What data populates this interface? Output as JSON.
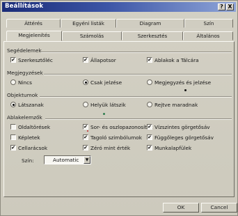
{
  "window": {
    "title": "Beállítások",
    "help_glyph": "?",
    "close_glyph": "X"
  },
  "tabs_row1": [
    "Áttérés",
    "Egyéni listák",
    "Diagram",
    "Szín"
  ],
  "tabs_row2": [
    "Megjelenítés",
    "Számolás",
    "Szerkesztés",
    "Általános"
  ],
  "active_tab": "Megjelenítés",
  "groups": {
    "segedelemek": {
      "label": "Segédelemek",
      "items": [
        {
          "label": "Szerkesztőléc",
          "checked": true
        },
        {
          "label": "Állapotsor",
          "checked": true
        },
        {
          "label": "Ablakok a Tálcára",
          "checked": true
        }
      ]
    },
    "megjegyzesek": {
      "label": "Megjegyzések",
      "items": [
        {
          "label": "Nincs",
          "selected": false
        },
        {
          "label": "Csak jelzése",
          "selected": true
        },
        {
          "label": "Megjegyzés és jelzése",
          "selected": false
        }
      ]
    },
    "objektumok": {
      "label": "Objektumok",
      "items": [
        {
          "label": "Látszanak",
          "selected": true
        },
        {
          "label": "Helyük látszik",
          "selected": false
        },
        {
          "label": "Rejtve maradnak",
          "selected": false
        }
      ]
    },
    "ablakelemek": {
      "label": "Ablakelemzők",
      "items": [
        {
          "label": "Oldaltörések",
          "checked": false
        },
        {
          "label": "Sor- és oszlopazonosítók",
          "checked": true
        },
        {
          "label": "Vízszintes görgetősáv",
          "checked": true
        },
        {
          "label": "Képletek",
          "checked": false
        },
        {
          "label": "Tagoló szimbólumok",
          "checked": true
        },
        {
          "label": "Függőleges görgetősáv",
          "checked": true
        },
        {
          "label": "Cellarácsok",
          "checked": true
        },
        {
          "label": "Zéró mint érték",
          "checked": true
        },
        {
          "label": "Munkalapfülek",
          "checked": true
        }
      ],
      "color_label": "Szín:",
      "color_value": "Automatic"
    }
  },
  "buttons": {
    "ok": "OK",
    "cancel": "Cancel"
  },
  "check_glyph": "✔",
  "colors": {
    "title_start": "#1a2c78",
    "title_end": "#8fa5d8",
    "dialog": "#d3d0c4"
  }
}
